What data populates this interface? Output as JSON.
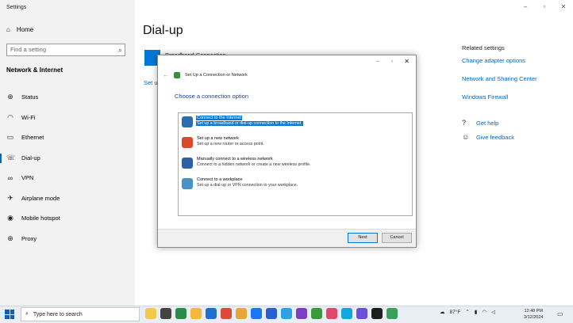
{
  "settings": {
    "app_title": "Settings",
    "window_controls": [
      "–",
      "▫",
      "✕"
    ],
    "home": "Home",
    "search_placeholder": "Find a setting",
    "section": "Network & Internet",
    "nav": [
      {
        "label": "Status",
        "icon": "globe-icon",
        "glyph": "⊕"
      },
      {
        "label": "Wi-Fi",
        "icon": "wifi-icon",
        "glyph": "◠"
      },
      {
        "label": "Ethernet",
        "icon": "ethernet-icon",
        "glyph": "▭"
      },
      {
        "label": "Dial-up",
        "icon": "phone-icon",
        "glyph": "☏",
        "active": true
      },
      {
        "label": "VPN",
        "icon": "vpn-icon",
        "glyph": "∞"
      },
      {
        "label": "Airplane mode",
        "icon": "airplane-icon",
        "glyph": "✈"
      },
      {
        "label": "Mobile hotspot",
        "icon": "hotspot-icon",
        "glyph": "◉"
      },
      {
        "label": "Proxy",
        "icon": "proxy-icon",
        "glyph": "⊕"
      }
    ],
    "page_title": "Dial-up",
    "broadband_label": "Broadband Connection",
    "setup_link_partial": "Set u",
    "related_title": "Related settings",
    "related_links": [
      "Change adapter options",
      "Network and Sharing Center",
      "Windows Firewall"
    ],
    "help": [
      "Get help",
      "Give feedback"
    ]
  },
  "dialog": {
    "window_controls": [
      "–",
      "▫",
      "✕"
    ],
    "title": "Set Up a Connection or Network",
    "heading": "Choose a connection option",
    "options": [
      {
        "title": "Connect to the Internet",
        "desc": "Set up a broadband or dial-up connection to the Internet.",
        "selected": true,
        "color": "#2b6cb0"
      },
      {
        "title": "Set up a new network",
        "desc": "Set up a new router or access point.",
        "selected": false,
        "color": "#d84a2b"
      },
      {
        "title": "Manually connect to a wireless network",
        "desc": "Connect to a hidden network or create a new wireless profile.",
        "selected": false,
        "color": "#2f5fa8"
      },
      {
        "title": "Connect to a workplace",
        "desc": "Set up a dial-up or VPN connection to your workplace.",
        "selected": false,
        "color": "#4a90c8"
      }
    ],
    "next": "Next",
    "cancel": "Cancel"
  },
  "taskbar": {
    "search_placeholder": "Type here to search",
    "app_colors": [
      "#f4c84a",
      "#444444",
      "#2a8c4a",
      "#f6b73c",
      "#1f6fd1",
      "#d94a3a",
      "#e8a53a",
      "#1877f2",
      "#2a5fd1",
      "#2da1e1",
      "#7a3fc4",
      "#3a9a3a",
      "#e04a6a",
      "#12a7e0",
      "#6b4fd8",
      "#1e1e1e",
      "#3aa05a"
    ],
    "weather": "87°F",
    "time": "12:48 PM",
    "date": "3/12/2024"
  }
}
